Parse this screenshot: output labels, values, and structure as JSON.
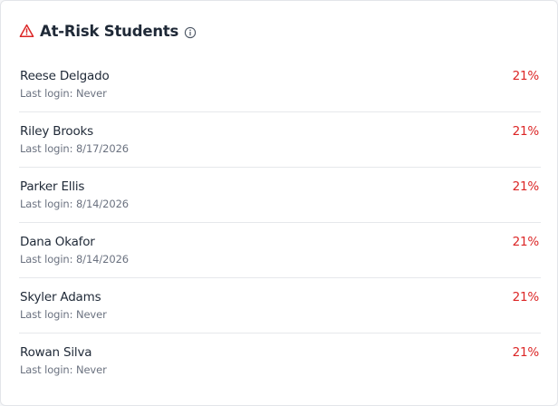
{
  "header": {
    "title": "At-Risk Students",
    "warning_icon": "warning-triangle-icon",
    "info_icon": "info-circle-icon"
  },
  "colors": {
    "danger": "#dc2626",
    "text_primary": "#1f2937",
    "text_secondary": "#6b7280",
    "divider": "#e6e8eb"
  },
  "students": [
    {
      "name": "Reese Delgado",
      "last_login": "Last login: Never",
      "score": "21%"
    },
    {
      "name": "Riley Brooks",
      "last_login": "Last login: 8/17/2026",
      "score": "21%"
    },
    {
      "name": "Parker Ellis",
      "last_login": "Last login: 8/14/2026",
      "score": "21%"
    },
    {
      "name": "Dana Okafor",
      "last_login": "Last login: 8/14/2026",
      "score": "21%"
    },
    {
      "name": "Skyler Adams",
      "last_login": "Last login: Never",
      "score": "21%"
    },
    {
      "name": "Rowan Silva",
      "last_login": "Last login: Never",
      "score": "21%"
    }
  ]
}
